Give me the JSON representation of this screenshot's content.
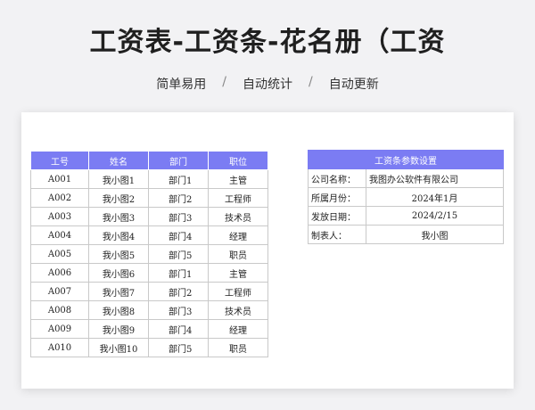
{
  "header": {
    "title": "工资表-工资条-花名册（工资",
    "tags": [
      "简单易用",
      "自动统计",
      "自动更新"
    ],
    "separator": "/"
  },
  "colors": {
    "accent": "#7b7cf3",
    "background": "#f2f2f4"
  },
  "employee_table": {
    "headers": [
      "工号",
      "姓名",
      "部门",
      "职位"
    ],
    "rows": [
      [
        "A001",
        "我小图1",
        "部门1",
        "主管"
      ],
      [
        "A002",
        "我小图2",
        "部门2",
        "工程师"
      ],
      [
        "A003",
        "我小图3",
        "部门3",
        "技术员"
      ],
      [
        "A004",
        "我小图4",
        "部门4",
        "经理"
      ],
      [
        "A005",
        "我小图5",
        "部门5",
        "职员"
      ],
      [
        "A006",
        "我小图6",
        "部门1",
        "主管"
      ],
      [
        "A007",
        "我小图7",
        "部门2",
        "工程师"
      ],
      [
        "A008",
        "我小图8",
        "部门3",
        "技术员"
      ],
      [
        "A009",
        "我小图9",
        "部门4",
        "经理"
      ],
      [
        "A010",
        "我小图10",
        "部门5",
        "职员"
      ]
    ]
  },
  "settings": {
    "title": "工资条参数设置",
    "rows": [
      {
        "label": "公司名称：",
        "value": "我图办公软件有限公司"
      },
      {
        "label": "所属月份：",
        "value": "2024年1月"
      },
      {
        "label": "发放日期：",
        "value": "2024/2/15"
      },
      {
        "label": "制表人：",
        "value": "我小图"
      }
    ]
  }
}
